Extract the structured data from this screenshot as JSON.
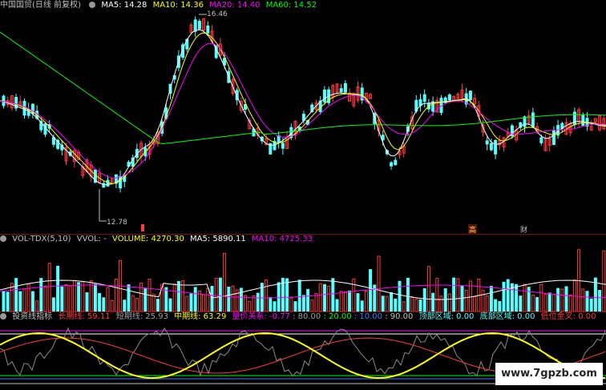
{
  "price_header": {
    "title": "中国国贸(日线 前复权)",
    "ma5": "MA5: 14.28",
    "ma10": "MA10: 14.36",
    "ma20": "MA20: 14.40",
    "ma60": "MA60: 14.52",
    "high_label": "16.46",
    "low_label": "12.78",
    "tag_gao": "高",
    "tag_cai": "财"
  },
  "vol_header": {
    "title": "VOL-TDX(5,10)",
    "vvol": "VVOL: -",
    "volume": "VOLUME: 4270.30",
    "ma5": "MA5: 5890.11",
    "ma10": "MA10: 4725.33"
  },
  "ind_header": {
    "title": "投资线指标",
    "long": "长期线: 59.11",
    "short": "短期线: 25.93",
    "mid": "中期线: 63.29",
    "qty_price": "量价关系: -0.77",
    "v80": ": 80.00",
    "v20": ": 20.00",
    "v10": ": 10.00",
    "v90": ": 90.00",
    "top_zone": "顶部区域: 0.00",
    "bottom_zone": "底部区域: 0.00",
    "gold_cross": "低位金叉: 0.00"
  },
  "watermark": "www.7gpzb.com",
  "colors": {
    "up": "#ff3a3a",
    "down": "#54ffff",
    "ma5": "#ffffff",
    "ma10": "#ffff00",
    "ma20": "#ff00ff",
    "ma60": "#00ff00"
  }
}
